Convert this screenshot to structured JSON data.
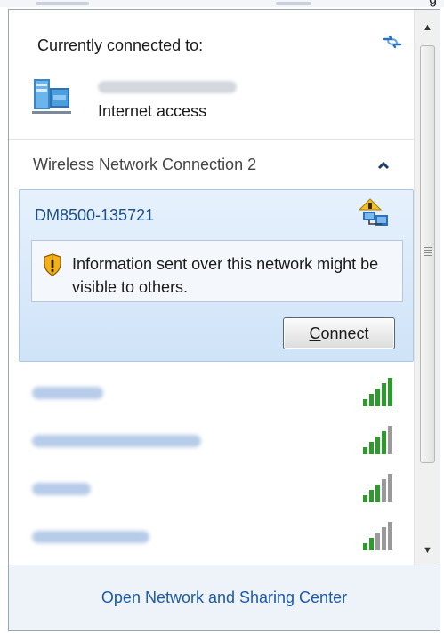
{
  "window": {
    "truncated_title_glyph": "g"
  },
  "header": {
    "title": "Currently connected to:",
    "icons": {
      "refresh": "refresh-arrows-icon",
      "connection": "network-computer-icon"
    },
    "access_label": "Internet access"
  },
  "section": {
    "label": "Wireless Network Connection 2",
    "collapse_icon": "chevron-up-icon"
  },
  "selected_network": {
    "ssid": "DM8500-135721",
    "icon": "open-network-icon",
    "warning": {
      "icon": "security-shield-icon",
      "text": "Information sent over this network might be visible to others."
    },
    "connect_button": {
      "accel": "C",
      "rest": "onnect"
    }
  },
  "other_networks": [
    {
      "signal_bars": 5,
      "icon": "signal-strength-icon"
    },
    {
      "signal_bars": 4,
      "icon": "signal-strength-icon"
    },
    {
      "signal_bars": 3,
      "icon": "signal-strength-icon"
    },
    {
      "signal_bars": 2,
      "icon": "signal-strength-icon"
    }
  ],
  "scrollbar": {
    "up_icon": "scroll-up-arrow-icon",
    "down_icon": "scroll-down-arrow-icon"
  },
  "footer": {
    "link": "Open Network and Sharing Center"
  },
  "colors": {
    "link_blue": "#1d5aa6",
    "ssid_blue": "#1b4f8a",
    "signal_green": "#2e9a2e",
    "signal_gray": "#9a9a9a",
    "selection_bg": "#cfe3f8"
  }
}
